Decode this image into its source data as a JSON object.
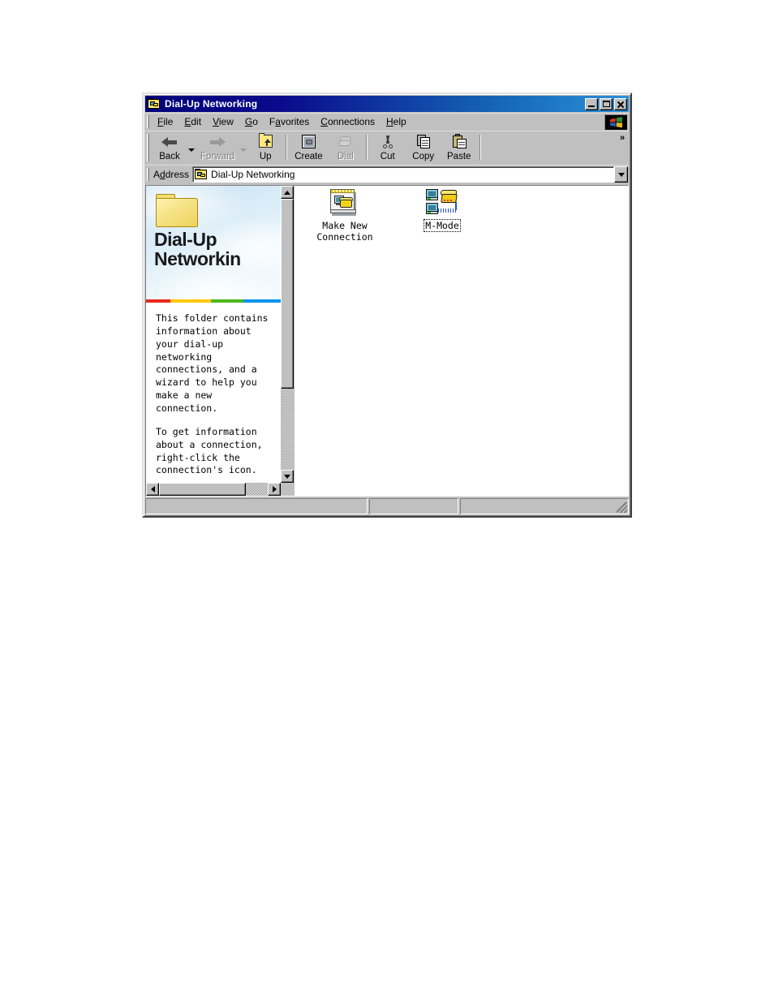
{
  "window": {
    "title": "Dial-Up Networking",
    "icon": "folder-dialup-icon",
    "buttons": {
      "minimize": "Minimize",
      "maximize": "Maximize",
      "close": "Close"
    }
  },
  "menu": {
    "items": [
      {
        "label": "File",
        "accel": "F",
        "pre": "",
        "post": "ile"
      },
      {
        "label": "Edit",
        "accel": "E",
        "pre": "",
        "post": "dit"
      },
      {
        "label": "View",
        "accel": "V",
        "pre": "",
        "post": "iew"
      },
      {
        "label": "Go",
        "accel": "G",
        "pre": "",
        "post": "o"
      },
      {
        "label": "Favorites",
        "accel": "a",
        "pre": "F",
        "post": "vorites"
      },
      {
        "label": "Connections",
        "accel": "C",
        "pre": "",
        "post": "onnections"
      },
      {
        "label": "Help",
        "accel": "H",
        "pre": "",
        "post": "elp"
      }
    ],
    "logo": "windows-logo-icon"
  },
  "toolbar": {
    "items": [
      {
        "label": "Back",
        "icon": "back-arrow-icon",
        "enabled": true,
        "dropdown": true
      },
      {
        "label": "Forward",
        "icon": "forward-arrow-icon",
        "enabled": false,
        "dropdown": true
      },
      {
        "label": "Up",
        "icon": "up-folder-icon",
        "enabled": true,
        "dropdown": false
      },
      {
        "label": "Create",
        "icon": "create-connection-icon",
        "enabled": true,
        "dropdown": false
      },
      {
        "label": "Dial",
        "icon": "dial-phone-icon",
        "enabled": false,
        "dropdown": false
      },
      {
        "label": "Cut",
        "icon": "scissors-icon",
        "enabled": true,
        "dropdown": false
      },
      {
        "label": "Copy",
        "icon": "copy-pages-icon",
        "enabled": true,
        "dropdown": false
      },
      {
        "label": "Paste",
        "icon": "clipboard-paste-icon",
        "enabled": true,
        "dropdown": false
      }
    ],
    "overflow_label": "»"
  },
  "address": {
    "label_pre": "A",
    "label_accel": "d",
    "label_post": "dress",
    "value": "Dial-Up Networking",
    "icon": "folder-dialup-icon",
    "dropdown": "chevron-down-icon"
  },
  "webview": {
    "title_line1": "Dial-Up",
    "title_line2": "Networkin",
    "folder_icon": "large-folder-icon",
    "divider_colors": [
      "#e8281c",
      "#ffc800",
      "#4cb81e",
      "#0094ee"
    ],
    "paragraphs": [
      "This folder contains information about your dial-up networking connections, and a wizard to help you make a new connection.",
      "To get information about a connection, right-click the connection's icon."
    ]
  },
  "icons": [
    {
      "label": "Make New Connection",
      "icon": "make-new-connection-icon",
      "focused": false
    },
    {
      "label": "M-Mode",
      "icon": "dialup-connection-icon",
      "focused": true
    }
  ],
  "statusbar": {
    "pane1": "",
    "pane2": "",
    "pane3": "",
    "resize_grip": "resize-grip-icon"
  },
  "colors": {
    "titlebar_start": "#00007b",
    "titlebar_end": "#2a8fd8",
    "face": "#c0c0c0",
    "banner_sky": "#c4dff0"
  }
}
